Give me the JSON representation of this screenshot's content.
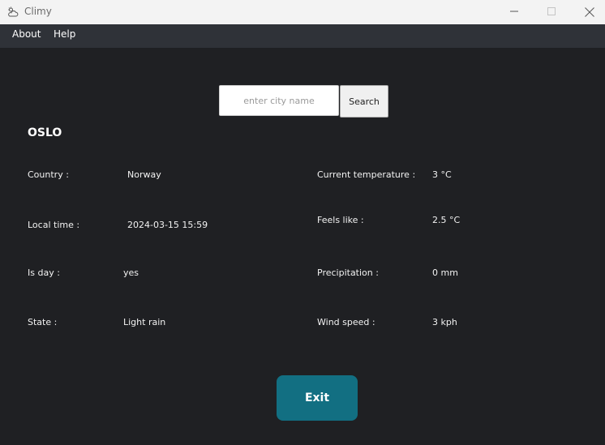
{
  "window": {
    "title": "Climy",
    "icon": "cloud-sun-icon",
    "controls": [
      "minimize-icon",
      "maximize-icon",
      "close-icon"
    ]
  },
  "menu": {
    "about": "About",
    "help": "Help"
  },
  "search": {
    "placeholder": "enter city name",
    "value": "",
    "button_label": "Search"
  },
  "city": "OSLO",
  "left_info": {
    "country_label": "Country :",
    "country_value": "Norway",
    "local_time_label": "Local time :",
    "local_time_value": "2024-03-15 15:59",
    "is_day_label": "Is day :",
    "is_day_value": "yes",
    "state_label": "State :",
    "state_value": "Light rain"
  },
  "right_info": {
    "temperature_label": "Current temperature :",
    "temperature_value": "3 °C",
    "feels_like_label": "Feels like :",
    "feels_like_value": "2.5 °C",
    "precipitation_label": "Precipitation :",
    "precipitation_value": "0 mm",
    "wind_speed_label": "Wind speed :",
    "wind_speed_value": "3 kph"
  },
  "exit_label": "Exit",
  "colors": {
    "background": "#1f2023",
    "menubar": "#2f3238",
    "titlebar": "#f3f3f3",
    "accent": "#126f82"
  }
}
